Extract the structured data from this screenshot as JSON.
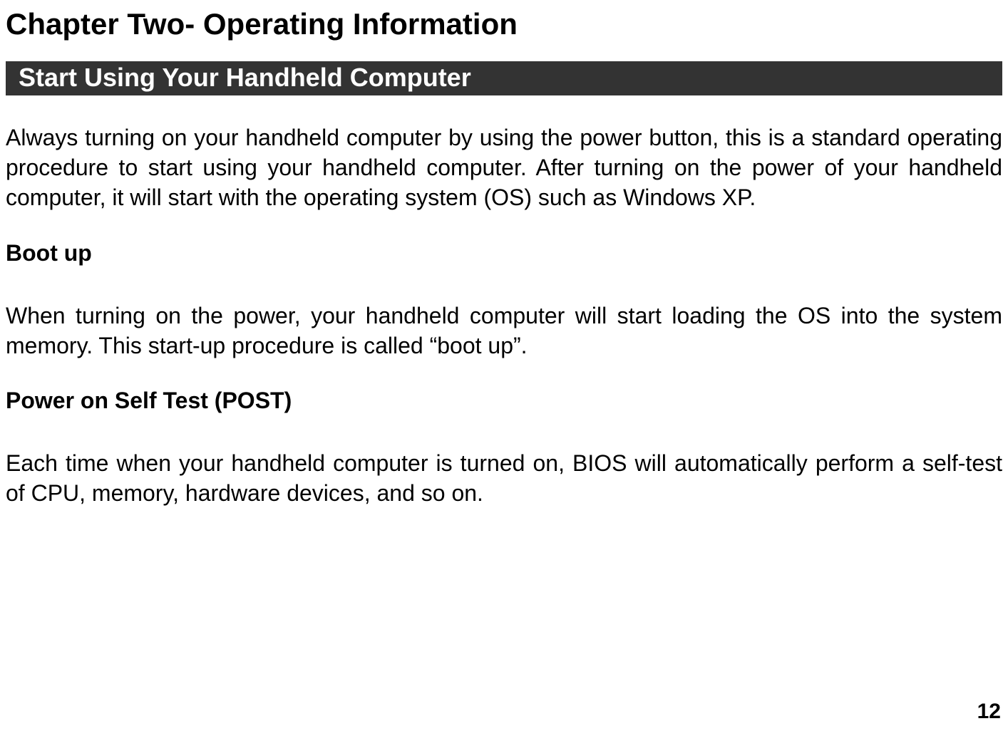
{
  "chapter": {
    "title": "Chapter Two- Operating Information"
  },
  "section": {
    "banner": "Start Using Your Handheld Computer",
    "intro_paragraph": "Always turning on your handheld computer by using the power button, this is a standard operating procedure to start using your handheld computer. After turning on the power of your handheld computer, it will start with the operating system (OS) such as Windows XP."
  },
  "subsections": {
    "bootup": {
      "heading": "Boot up",
      "text": "When turning on the power, your handheld computer will start loading the OS into the system memory. This start-up procedure is called “boot up”."
    },
    "post": {
      "heading": "Power on Self Test (POST)",
      "text": "Each time when your handheld computer is turned on, BIOS will automatically perform a self-test of CPU, memory, hardware devices, and so on."
    }
  },
  "page_number": "12"
}
